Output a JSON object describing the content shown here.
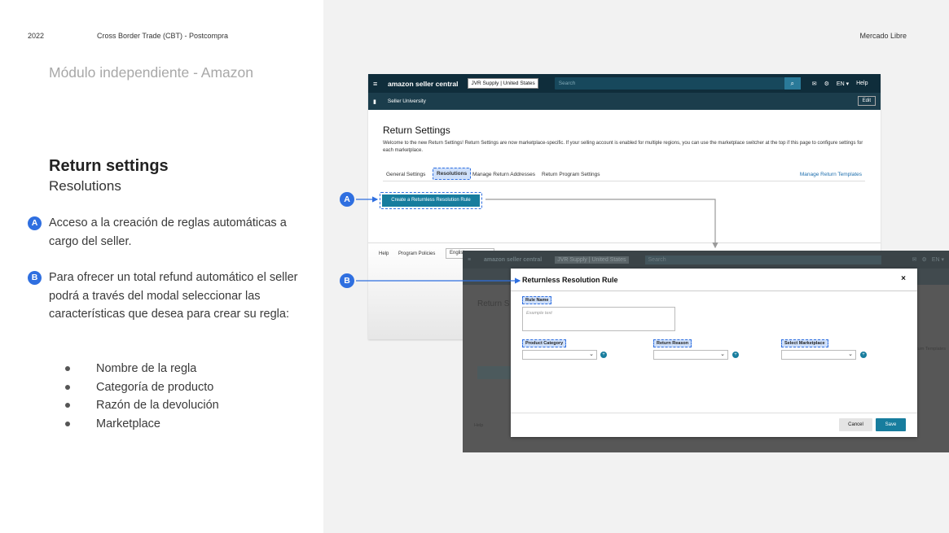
{
  "header": {
    "year": "2022",
    "course": "Cross Border Trade (CBT) - Postcompra",
    "brand": "Mercado Libre"
  },
  "left": {
    "module_title": "Módulo independiente - Amazon",
    "section_title": "Return settings",
    "section_subtitle": "Resolutions",
    "points": [
      {
        "badge": "A",
        "text": "Acceso a la creación de reglas automáticas a cargo del seller."
      },
      {
        "badge": "B",
        "text": "Para ofrecer un total refund automático el seller podrá a través del modal seleccionar las características que desea para crear su regla:"
      }
    ],
    "bullets": [
      "Nombre de la regla",
      "Categoría de producto",
      "Razón de la devolución",
      "Marketplace"
    ]
  },
  "screen1": {
    "logo": "amazon seller central",
    "store": "JVR Supply | United States",
    "search_placeholder": "Search",
    "lang": "EN ▾",
    "help": "Help",
    "bookmark": "Seller University",
    "edit": "Edit",
    "title": "Return Settings",
    "description": "Welcome to the new Return Settings! Return Settings are now marketplace-specific. If your selling account is enabled for multiple regions, you can use the marketplace switcher at the top if this page to configure settings for each marketplace.",
    "tabs": [
      "General Settings",
      "Resolutions",
      "Manage Return Addresses",
      "Return Program Settings"
    ],
    "manage_templates": "Manage Return Templates",
    "cta": "Create a Returnless Resolution Rule",
    "footer_help": "Help",
    "footer_policies": "Program Policies",
    "footer_lang": "English"
  },
  "screen2": {
    "logo": "amazon seller central",
    "store": "JVR Supply | United States",
    "search_placeholder": "Search",
    "lang": "EN ▾",
    "bg_title": "Return S",
    "bg_templates": "Return Templates",
    "bg_help": "Help"
  },
  "modal": {
    "title": "Returnless Resolution Rule",
    "close": "×",
    "rule_name_label": "Rule Name",
    "rule_name_placeholder": "Example text",
    "product_category_label": "Product Category",
    "return_reason_label": "Return Reason",
    "marketplace_label": "Select Marketplace",
    "cancel": "Cancel",
    "save": "Save"
  },
  "callouts": {
    "a": "A",
    "b": "B"
  },
  "colors": {
    "accent_blue": "#2f6fe0",
    "amazon_nav": "#0f2d3b",
    "button_teal": "#177d9e"
  }
}
